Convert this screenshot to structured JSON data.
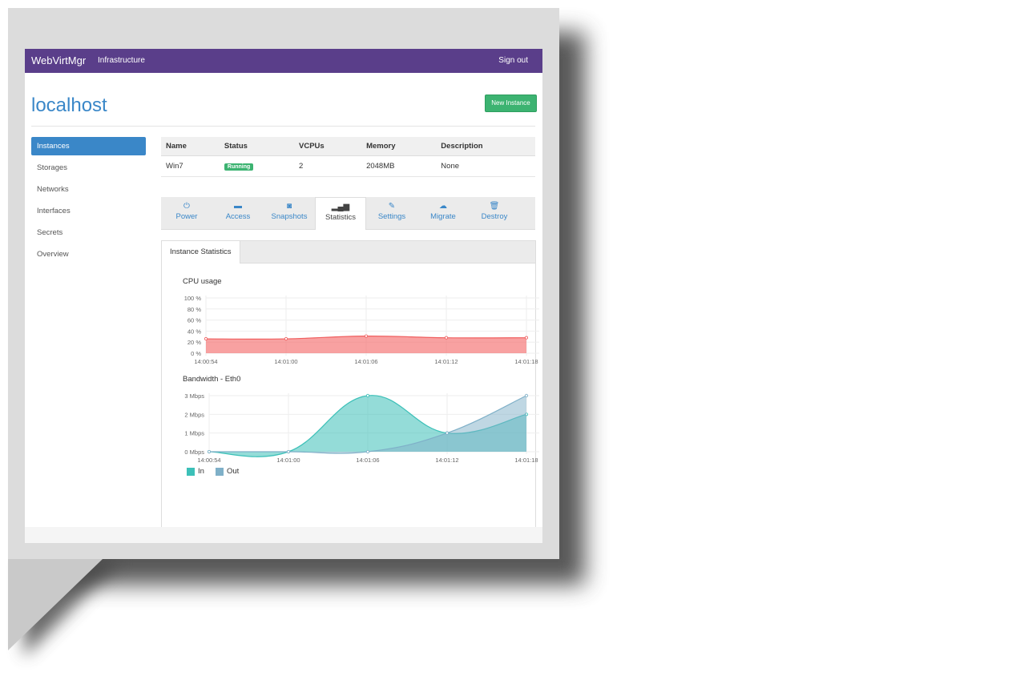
{
  "nav": {
    "brand": "WebVirtMgr",
    "infrastructure": "Infrastructure",
    "sign_out": "Sign out"
  },
  "page": {
    "title": "localhost",
    "new_instance": "New Instance"
  },
  "sidebar": {
    "items": [
      {
        "label": "Instances",
        "active": true
      },
      {
        "label": "Storages"
      },
      {
        "label": "Networks"
      },
      {
        "label": "Interfaces"
      },
      {
        "label": "Secrets"
      },
      {
        "label": "Overview"
      }
    ]
  },
  "table": {
    "headers": [
      "Name",
      "Status",
      "VCPUs",
      "Memory",
      "Description"
    ],
    "rows": [
      {
        "name": "Win7",
        "status": "Running",
        "vcpus": "2",
        "memory": "2048MB",
        "description": "None"
      }
    ]
  },
  "tabs": [
    {
      "label": "Power",
      "icon": "power-icon"
    },
    {
      "label": "Access",
      "icon": "briefcase-icon"
    },
    {
      "label": "Snapshots",
      "icon": "camera-icon"
    },
    {
      "label": "Statistics",
      "icon": "signal-icon",
      "active": true
    },
    {
      "label": "Settings",
      "icon": "wrench-icon"
    },
    {
      "label": "Migrate",
      "icon": "cloud-upload-icon"
    },
    {
      "label": "Destroy",
      "icon": "trash-icon"
    }
  ],
  "panel_tab": "Instance Statistics",
  "colors": {
    "nav": "#5a3e8a",
    "accent": "#3a87c8",
    "success": "#3cb371",
    "cpu": "#f06060",
    "in": "#3cc0b8",
    "out": "#7fb0c8"
  },
  "chart_data": [
    {
      "type": "area",
      "title": "CPU usage",
      "categories": [
        "14:00:54",
        "14:01:00",
        "14:01:06",
        "14:01:12",
        "14:01:18"
      ],
      "yticks": [
        "0 %",
        "20 %",
        "40 %",
        "60 %",
        "80 %",
        "100 %"
      ],
      "ylim": [
        0,
        100
      ],
      "series": [
        {
          "values": [
            26,
            26,
            31,
            28,
            28
          ]
        }
      ],
      "grid": true
    },
    {
      "type": "area",
      "title": "Bandwidth - Eth0",
      "categories": [
        "14:00:54",
        "14:01:00",
        "14:01:06",
        "14:01:12",
        "14:01:18"
      ],
      "yticks": [
        "0 Mbps",
        "1 Mbps",
        "2 Mbps",
        "3 Mbps"
      ],
      "ylim": [
        0,
        3
      ],
      "series": [
        {
          "name": "In",
          "values": [
            0,
            0,
            3,
            1,
            2
          ]
        },
        {
          "name": "Out",
          "values": [
            0,
            0,
            0,
            1,
            3
          ]
        }
      ],
      "grid": true,
      "legend": "bottom-left"
    }
  ]
}
